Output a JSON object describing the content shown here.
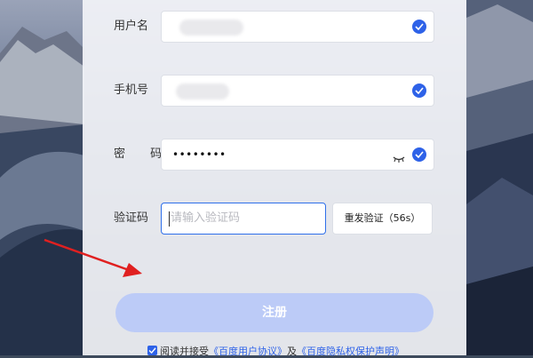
{
  "form": {
    "username": {
      "label": "用户名",
      "value": ""
    },
    "phone": {
      "label": "手机号",
      "value": ""
    },
    "password": {
      "label": "密 码",
      "value": "••••••••"
    },
    "captcha": {
      "label": "验证码",
      "placeholder": "请输入验证码"
    },
    "sms_button_label": "重发验证（56s）",
    "register_label": "注册"
  },
  "agreement": {
    "prefix": "阅读并接受",
    "user_agreement": "《百度用户协议》",
    "connector": "及",
    "privacy": "《百度隐私权保护声明》",
    "checked": true
  },
  "colors": {
    "accent": "#2e62e8",
    "register_disabled": "#bccbf7",
    "annotation_arrow": "#e02020"
  },
  "icons": [
    "check-icon",
    "eye-closed-icon"
  ]
}
